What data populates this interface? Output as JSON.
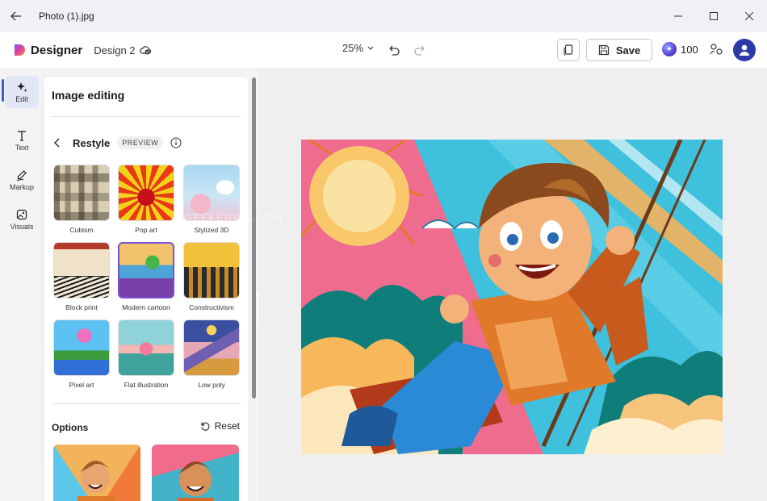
{
  "window": {
    "title": "Photo (1).jpg"
  },
  "app": {
    "brand": "Designer",
    "design_name": "Design 2",
    "zoom": "25%",
    "save_label": "Save",
    "credits": "100"
  },
  "rail": [
    {
      "label": "Edit",
      "icon": "sparkle-icon",
      "active": true
    },
    {
      "label": "Text",
      "icon": "text-icon"
    },
    {
      "label": "Markup",
      "icon": "pen-icon"
    },
    {
      "label": "Visuals",
      "icon": "image-icon"
    }
  ],
  "panel": {
    "title": "Image editing",
    "restyle_label": "Restyle",
    "preview_badge": "PREVIEW",
    "styles": [
      {
        "label": "Cubism"
      },
      {
        "label": "Pop art"
      },
      {
        "label": "Stylized 3D"
      },
      {
        "label": "Block print"
      },
      {
        "label": "Modern cartoon",
        "selected": true
      },
      {
        "label": "Constructivism"
      },
      {
        "label": "Pixel art"
      },
      {
        "label": "Flat illustration"
      },
      {
        "label": "Low poly"
      }
    ],
    "options_title": "Options",
    "reset_label": "Reset"
  },
  "watermark": "GEEKERWO.COM",
  "colors": {
    "accent": "#3b5bdb",
    "selected": "#7a4fd6",
    "avatar": "#2b3aa8"
  }
}
